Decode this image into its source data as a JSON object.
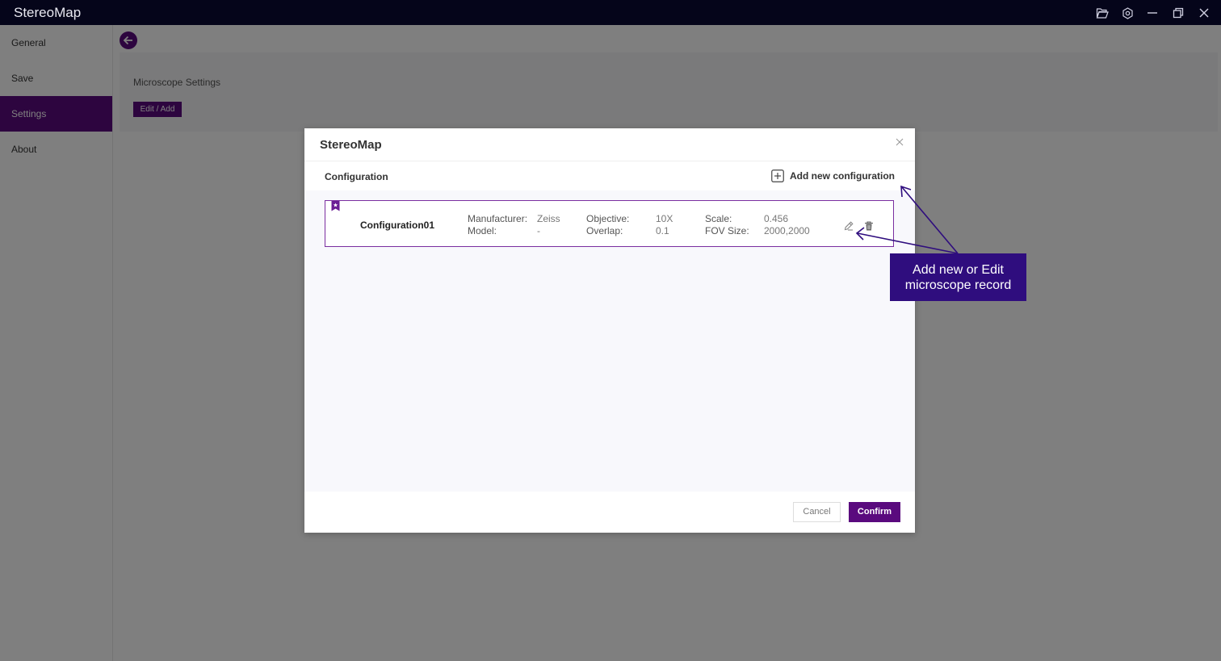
{
  "app": {
    "title": "StereoMap"
  },
  "sidebar": {
    "items": [
      {
        "label": "General",
        "active": false
      },
      {
        "label": "Save",
        "active": false
      },
      {
        "label": "Settings",
        "active": true
      },
      {
        "label": "About",
        "active": false
      }
    ]
  },
  "main": {
    "panel_label": "Microscope Settings",
    "edit_add_label": "Edit / Add"
  },
  "modal": {
    "title": "StereoMap",
    "section_label": "Configuration",
    "add_label": "Add new configuration",
    "configs": [
      {
        "name": "Configuration01",
        "manufacturer_label": "Manufacturer:",
        "manufacturer": "Zeiss",
        "model_label": "Model:",
        "model": "-",
        "objective_label": "Objective:",
        "objective": "10X",
        "overlap_label": "Overlap:",
        "overlap": "0.1",
        "scale_label": "Scale:",
        "scale": "0.456",
        "fov_label": "FOV Size:",
        "fov": "2000,2000"
      }
    ],
    "cancel_label": "Cancel",
    "confirm_label": "Confirm"
  },
  "annotation": {
    "line1": "Add new or Edit",
    "line2": "microscope record"
  },
  "colors": {
    "accent": "#5a0a7e",
    "titlebar": "#05051a",
    "callout": "#2f0d7e"
  }
}
